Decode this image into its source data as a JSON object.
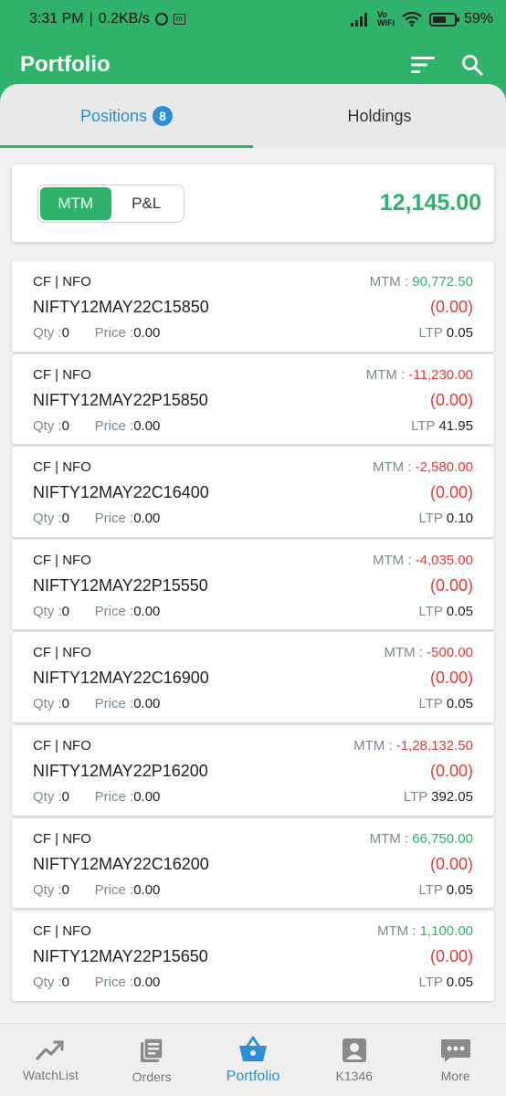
{
  "status_bar": {
    "time": "3:31 PM",
    "speed": "0.2KB/s",
    "volte": "Vo\nWiFi",
    "battery": "59%"
  },
  "app": {
    "title": "Portfolio",
    "sort_icon": "sort-icon",
    "search_icon": "search-icon"
  },
  "tabs": [
    {
      "label": "Positions",
      "badge": "8",
      "active": true
    },
    {
      "label": "Holdings",
      "active": false
    }
  ],
  "summary": {
    "toggle": [
      {
        "label": "MTM",
        "active": true
      },
      {
        "label": "P&L",
        "active": false
      }
    ],
    "total": "12,145.00",
    "total_color": "#2fb36b"
  },
  "labels": {
    "mtm": "MTM : ",
    "qty": "Qty : ",
    "price": "Price : ",
    "ltp": "LTP "
  },
  "positions": [
    {
      "segment": "CF | NFO",
      "symbol": "NIFTY12MAY22C15850",
      "mtm": "90,772.50",
      "mtm_positive": true,
      "change": "(0.00)",
      "qty": "0",
      "price": "0.00",
      "ltp": "0.05"
    },
    {
      "segment": "CF | NFO",
      "symbol": "NIFTY12MAY22P15850",
      "mtm": "-11,230.00",
      "mtm_positive": false,
      "change": "(0.00)",
      "qty": "0",
      "price": "0.00",
      "ltp": "41.95"
    },
    {
      "segment": "CF | NFO",
      "symbol": "NIFTY12MAY22C16400",
      "mtm": "-2,580.00",
      "mtm_positive": false,
      "change": "(0.00)",
      "qty": "0",
      "price": "0.00",
      "ltp": "0.10"
    },
    {
      "segment": "CF | NFO",
      "symbol": "NIFTY12MAY22P15550",
      "mtm": "-4,035.00",
      "mtm_positive": false,
      "change": "(0.00)",
      "qty": "0",
      "price": "0.00",
      "ltp": "0.05"
    },
    {
      "segment": "CF | NFO",
      "symbol": "NIFTY12MAY22C16900",
      "mtm": "-500.00",
      "mtm_positive": false,
      "change": "(0.00)",
      "qty": "0",
      "price": "0.00",
      "ltp": "0.05"
    },
    {
      "segment": "CF | NFO",
      "symbol": "NIFTY12MAY22P16200",
      "mtm": "-1,28,132.50",
      "mtm_positive": false,
      "change": "(0.00)",
      "qty": "0",
      "price": "0.00",
      "ltp": "392.05"
    },
    {
      "segment": "CF | NFO",
      "symbol": "NIFTY12MAY22C16200",
      "mtm": "66,750.00",
      "mtm_positive": true,
      "change": "(0.00)",
      "qty": "0",
      "price": "0.00",
      "ltp": "0.05"
    },
    {
      "segment": "CF | NFO",
      "symbol": "NIFTY12MAY22P15650",
      "mtm": "1,100.00",
      "mtm_positive": true,
      "change": "(0.00)",
      "qty": "0",
      "price": "0.00",
      "ltp": "0.05"
    }
  ],
  "bottom_nav": [
    {
      "label": "WatchList",
      "icon": "trending-up-icon",
      "active": false
    },
    {
      "label": "Orders",
      "icon": "orders-icon",
      "active": false
    },
    {
      "label": "Portfolio",
      "icon": "basket-icon",
      "active": true
    },
    {
      "label": "K1346",
      "icon": "account-icon",
      "active": false
    },
    {
      "label": "More",
      "icon": "more-icon",
      "active": false
    }
  ],
  "colors": {
    "brand": "#2fb36b",
    "accent": "#2a8fd8",
    "negative": "#e53935"
  }
}
